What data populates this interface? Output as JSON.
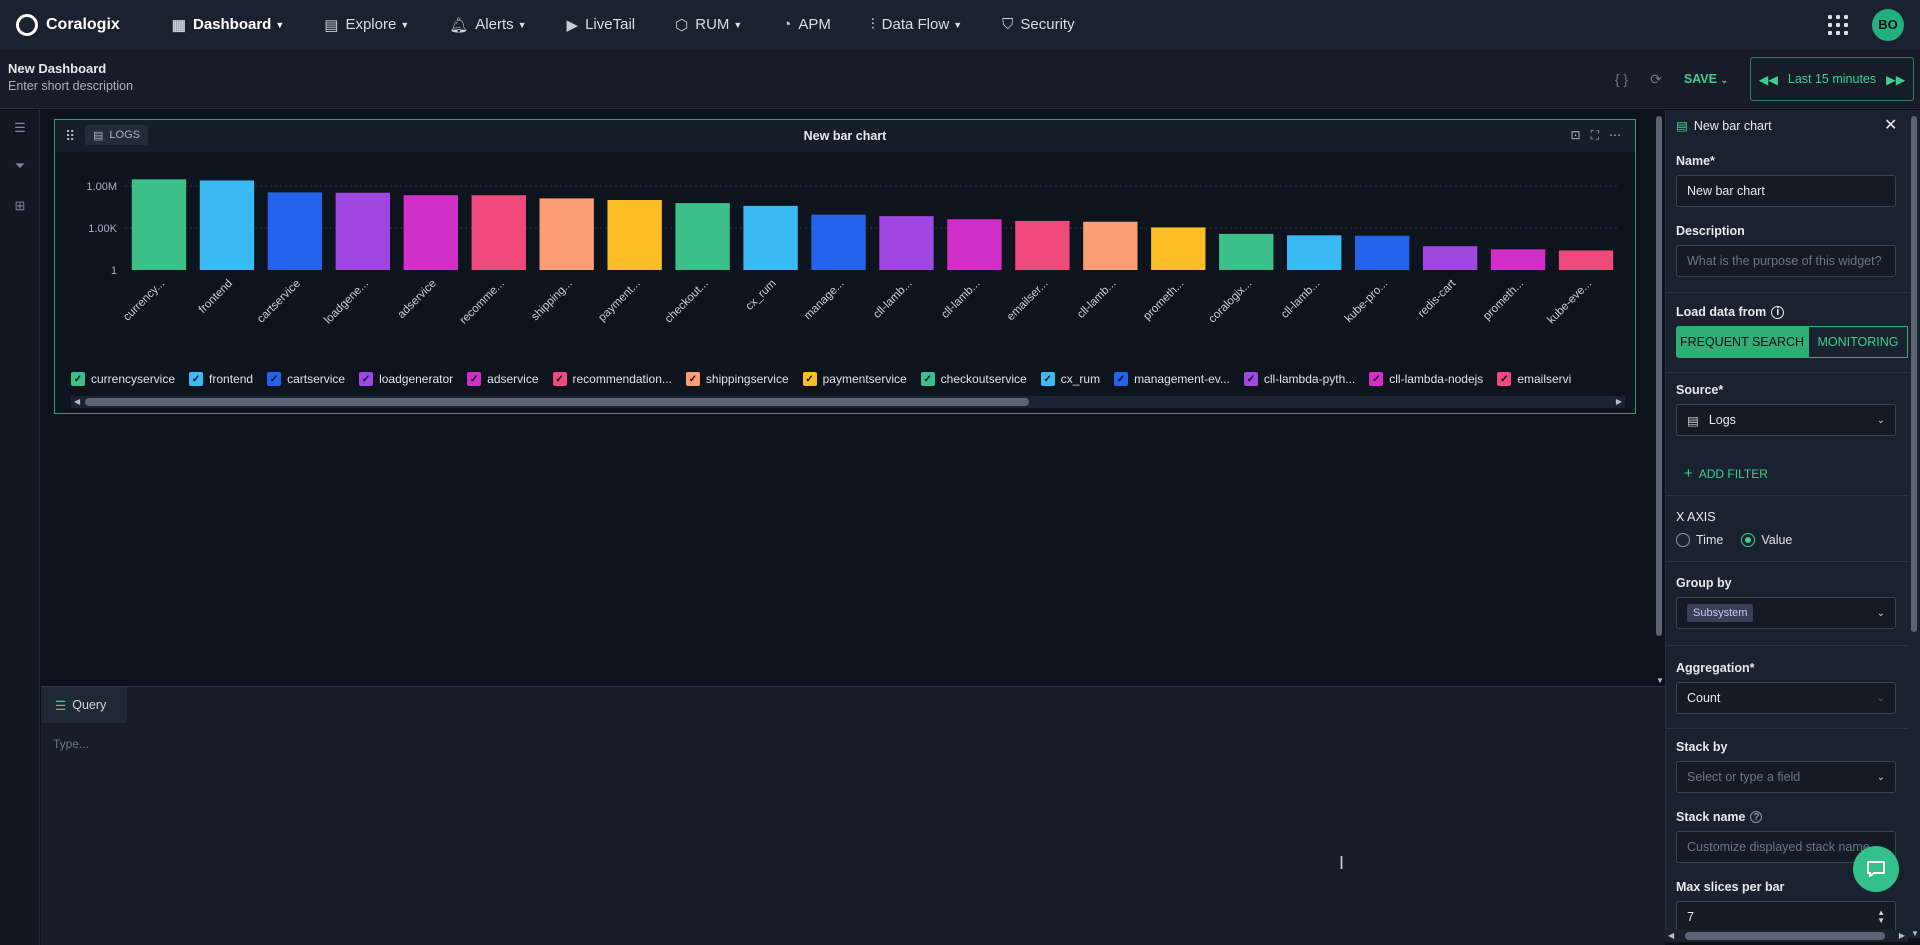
{
  "nav": {
    "brand": "Coralogix",
    "items": [
      {
        "id": "dashboard",
        "label": "Dashboard",
        "icon": "dashboard-icon",
        "caret": true,
        "active": true
      },
      {
        "id": "explore",
        "label": "Explore",
        "icon": "explore-icon",
        "caret": true
      },
      {
        "id": "alerts",
        "label": "Alerts",
        "icon": "bell-icon",
        "caret": true
      },
      {
        "id": "livetail",
        "label": "LiveTail",
        "icon": "play-icon",
        "caret": false
      },
      {
        "id": "rum",
        "label": "RUM",
        "icon": "rum-icon",
        "caret": true
      },
      {
        "id": "apm",
        "label": "APM",
        "icon": "apm-icon",
        "caret": false
      },
      {
        "id": "dataflow",
        "label": "Data Flow",
        "icon": "dataflow-icon",
        "caret": true
      },
      {
        "id": "security",
        "label": "Security",
        "icon": "shield-icon",
        "caret": false
      }
    ],
    "avatar": "BO"
  },
  "dashboard": {
    "title": "New Dashboard",
    "description": "Enter short description",
    "save_label": "SAVE",
    "time_range": "Last 15 minutes"
  },
  "widget": {
    "source_tag": "LOGS",
    "title": "New bar chart"
  },
  "chart_data": {
    "type": "bar",
    "yscale": "log",
    "yticks": [
      "1.00M",
      "1.00K",
      "1"
    ],
    "categories": [
      "currency...",
      "frontend",
      "cartservice",
      "loadgene...",
      "adservice",
      "recomme...",
      "shipping...",
      "payment...",
      "checkout...",
      "cx_rum",
      "manage...",
      "cll-lamb...",
      "cll-lamb...",
      "emailser...",
      "cll-lamb...",
      "prometh...",
      "coralogix...",
      "cll-lamb...",
      "kube-pro...",
      "redis-cart",
      "prometh...",
      "kube-eve..."
    ],
    "values": [
      3000000,
      2500000,
      350000,
      330000,
      220000,
      220000,
      130000,
      100000,
      60000,
      38000,
      9000,
      7000,
      4200,
      3200,
      2800,
      1100,
      380,
      300,
      280,
      50,
      30,
      25
    ],
    "colors": [
      "#3dbf8a",
      "#3bb9f2",
      "#2563eb",
      "#9f47e0",
      "#d12fc7",
      "#ef4a7c",
      "#fb9d74",
      "#fbbf24",
      "#3dbf8a",
      "#3bb9f2",
      "#2563eb",
      "#9f47e0",
      "#d12fc7",
      "#ef4a7c",
      "#fb9d74",
      "#fbbf24",
      "#3dbf8a",
      "#3bb9f2",
      "#2563eb",
      "#9f47e0",
      "#d12fc7",
      "#ef4a7c"
    ],
    "legend": [
      {
        "name": "currencyservice",
        "color": "#3dbf8a"
      },
      {
        "name": "frontend",
        "color": "#3bb9f2"
      },
      {
        "name": "cartservice",
        "color": "#2563eb"
      },
      {
        "name": "loadgenerator",
        "color": "#9f47e0"
      },
      {
        "name": "adservice",
        "color": "#d12fc7"
      },
      {
        "name": "recommendation...",
        "color": "#ef4a7c"
      },
      {
        "name": "shippingservice",
        "color": "#fb9d74"
      },
      {
        "name": "paymentservice",
        "color": "#fbbf24"
      },
      {
        "name": "checkoutservice",
        "color": "#3dbf8a"
      },
      {
        "name": "cx_rum",
        "color": "#3bb9f2"
      },
      {
        "name": "management-ev...",
        "color": "#2563eb"
      },
      {
        "name": "cll-lambda-pyth...",
        "color": "#9f47e0"
      },
      {
        "name": "cll-lambda-nodejs",
        "color": "#d12fc7"
      },
      {
        "name": "emailservi",
        "color": "#ef4a7c"
      }
    ]
  },
  "query": {
    "tab_label": "Query",
    "placeholder": "Type..."
  },
  "panel": {
    "title": "New bar chart",
    "name_label": "Name*",
    "name_value": "New bar chart",
    "description_label": "Description",
    "description_placeholder": "What is the purpose of this widget?",
    "load_from_label": "Load data from",
    "load_opt_on": "FREQUENT SEARCH",
    "load_opt_off": "MONITORING",
    "source_label": "Source*",
    "source_value": "Logs",
    "add_filter": "ADD FILTER",
    "xaxis_label": "X AXIS",
    "xaxis_time": "Time",
    "xaxis_value": "Value",
    "groupby_label": "Group by",
    "groupby_chip": "Subsystem",
    "agg_label": "Aggregation*",
    "agg_value": "Count",
    "stackby_label": "Stack by",
    "stackby_placeholder": "Select or type a field",
    "stackname_label": "Stack name",
    "stackname_placeholder": "Customize displayed stack name",
    "maxslices_label": "Max slices per bar",
    "maxslices_value": "7"
  }
}
